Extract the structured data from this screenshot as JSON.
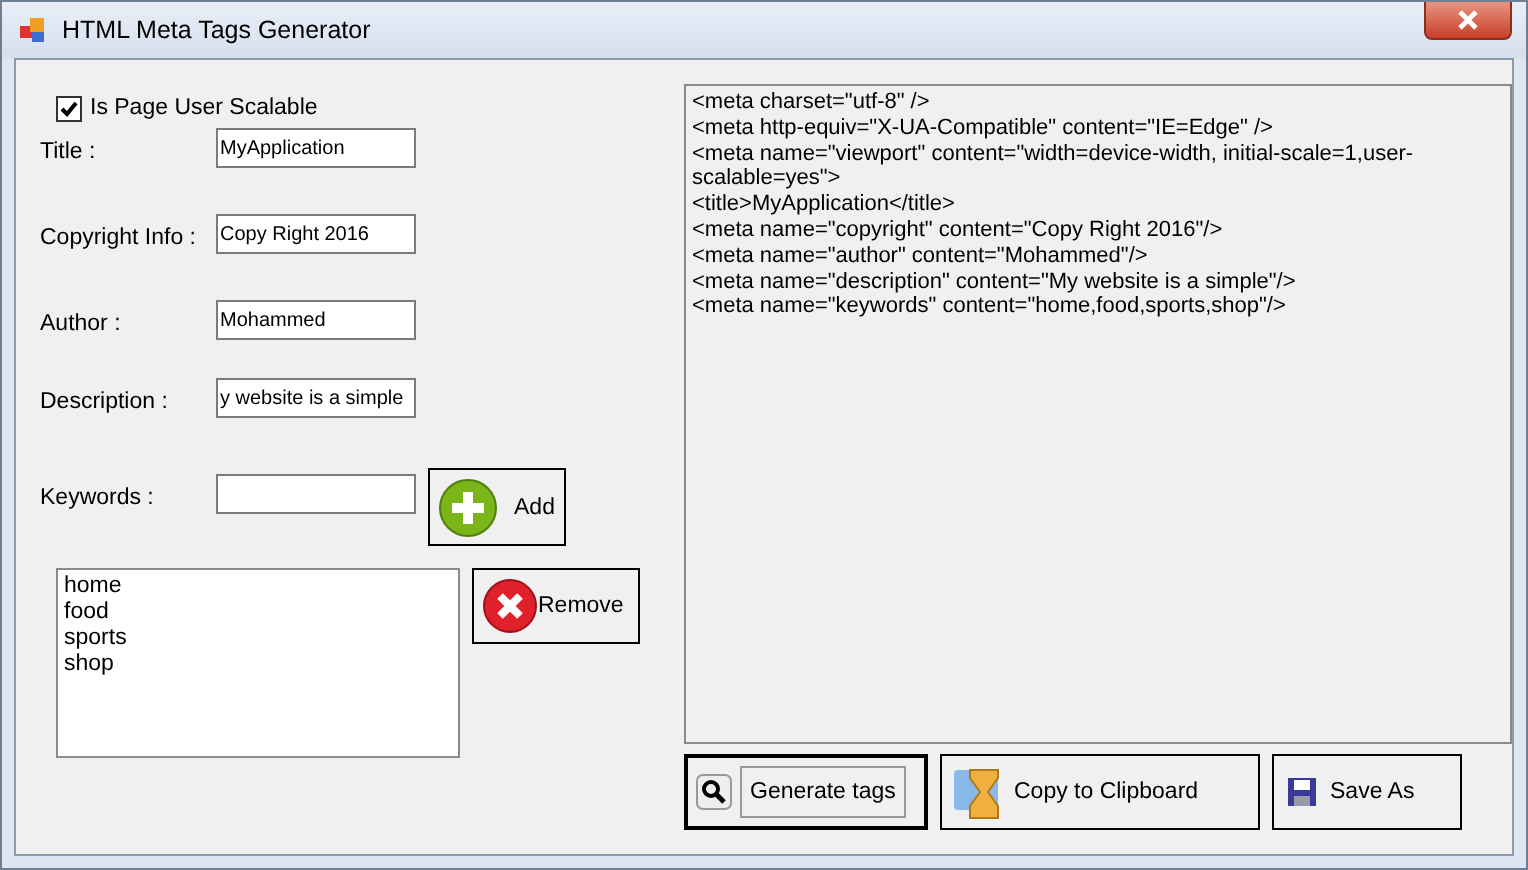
{
  "window": {
    "title": "HTML Meta Tags Generator"
  },
  "scalable": {
    "label": "Is Page User Scalable",
    "checked": true
  },
  "fields": [
    {
      "label": "Title :",
      "value": "MyApplication"
    },
    {
      "label": "Copyright Info :",
      "value": "Copy Right 2016"
    },
    {
      "label": "Author :",
      "value": "Mohammed"
    },
    {
      "label": "Description :",
      "value": "y website is a simple"
    },
    {
      "label": "Keywords :"
    }
  ],
  "add_button": "Add",
  "keywords_list": [
    "home",
    "food",
    "sports",
    "shop"
  ],
  "remove_button": "Remove",
  "output_lines": [
    "<meta charset=\"utf-8\" />",
    "<meta http-equiv=\"X-UA-Compatible\" content=\"IE=Edge\" />",
    "<meta name=\"viewport\" content=\"width=device-width, initial-scale=1,user-scalable=yes\">",
    "<title>MyApplication</title>",
    "<meta name=\"copyright\" content=\"Copy Right 2016\"/>",
    "<meta name=\"author\" content=\"Mohammed\"/>",
    "<meta name=\"description\" content=\"My website is a simple\"/>",
    "<meta name=\"keywords\" content=\"home,food,sports,shop\"/>"
  ],
  "buttons": [
    {
      "kind": "generate",
      "label": "Generate tags",
      "focused": true
    },
    {
      "kind": "copy",
      "label": "Copy to Clipboard",
      "focused": false
    },
    {
      "kind": "save",
      "label": "Save As",
      "focused": false
    }
  ]
}
